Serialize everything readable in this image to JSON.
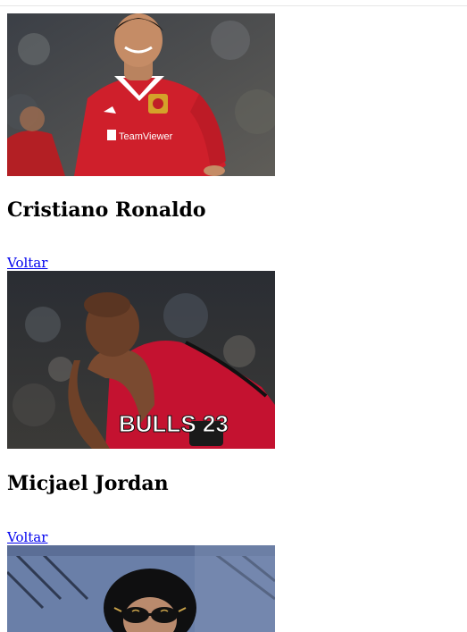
{
  "profiles": [
    {
      "name": "Cristiano Ronaldo",
      "link_label": "Voltar",
      "jersey_sponsor": "TeamViewer",
      "photo_icon": "athlete-photo-ronaldo"
    },
    {
      "name": "Micjael Jordan",
      "link_label": "Voltar",
      "jersey_text": "BULLS 23",
      "photo_icon": "athlete-photo-jordan"
    },
    {
      "photo_icon": "artist-photo-michael-jackson"
    }
  ]
}
